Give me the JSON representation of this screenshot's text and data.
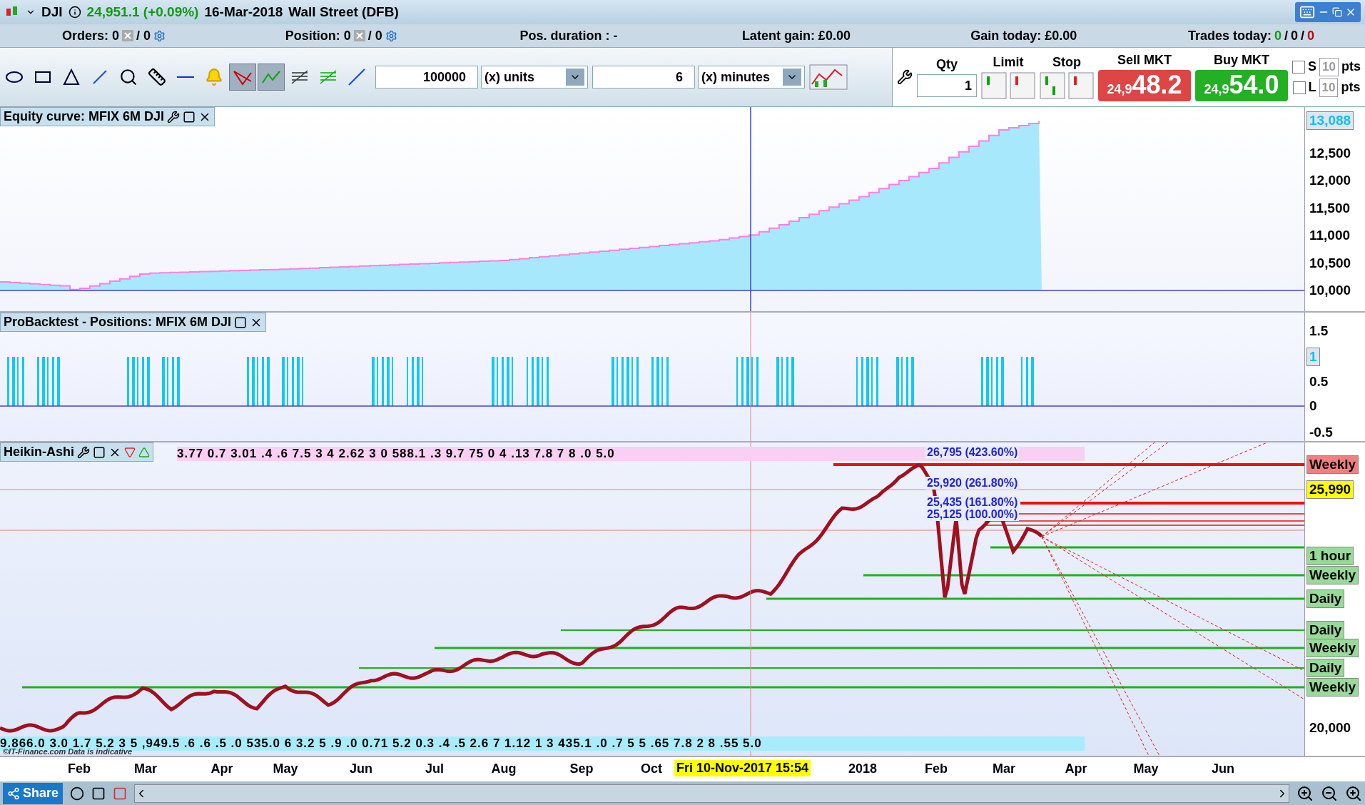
{
  "title_bar": {
    "symbol": "DJI",
    "price": "24,951.1 (+0.09%)",
    "date": "16-Mar-2018",
    "market": "Wall Street (DFB)"
  },
  "info_bar": [
    {
      "kind": "counter",
      "label": "Orders: 0",
      "rest": "/ 0"
    },
    {
      "kind": "counter",
      "label": "Position: 0",
      "rest": "/ 0"
    },
    {
      "kind": "text",
      "label": "Pos. duration : -"
    },
    {
      "kind": "text",
      "label": "Latent gain: £0.00"
    },
    {
      "kind": "text",
      "label": "Gain today: £0.00"
    },
    {
      "kind": "trades",
      "label": "Trades today:",
      "parts": [
        {
          "text": "0",
          "color": "#129a12"
        },
        {
          "text": "/",
          "color": "#000000"
        },
        {
          "text": "0",
          "color": "#000000"
        },
        {
          "text": "/",
          "color": "#000000"
        },
        {
          "text": "0",
          "color": "#c40000"
        }
      ]
    }
  ],
  "toolbar": {
    "tools": [
      {
        "selected": false
      },
      {
        "selected": false
      },
      {
        "selected": false
      },
      {
        "selected": false
      },
      {
        "selected": false
      },
      {
        "selected": false
      },
      {
        "selected": false
      },
      {
        "selected": false
      },
      {
        "selected": true
      },
      {
        "selected": true
      },
      {
        "selected": false
      },
      {
        "selected": false
      },
      {
        "selected": false
      }
    ],
    "quantity": "100000",
    "quantity_unit": "(x) units",
    "period": "6",
    "period_unit": "(x) minutes"
  },
  "order_panel": {
    "qty_label": "Qty",
    "qty": "1",
    "limit_label": "Limit",
    "stop_label": "Stop",
    "sell": {
      "label": "Sell MKT",
      "prefix": "24,9",
      "price": "48.2"
    },
    "buy": {
      "label": "Buy MKT",
      "prefix": "24,9",
      "price": "54.0"
    },
    "offsets": [
      {
        "label": "S",
        "value": "10",
        "unit": "pts",
        "checked": false
      },
      {
        "label": "L",
        "value": "10",
        "unit": "pts",
        "checked": false
      }
    ]
  },
  "equity_panel": {
    "title": "Equity curve: MFIX 6M DJI",
    "current": "13,088",
    "y_ticks": [
      "12,500",
      "12,000",
      "11,500",
      "11,000",
      "10,500",
      "10,000"
    ]
  },
  "positions_panel": {
    "title": "ProBacktest - Positions: MFIX 6M DJI",
    "current": "1",
    "y_ticks": [
      "1.5",
      "0.5",
      "0",
      "-0.5"
    ]
  },
  "price_panel": {
    "title": "Heikin-Ashi",
    "top_ribbon": "3.77 0.7 3.01 .4 .6 7.5 3 4 2.62 3 0 588.1 .3 9.7 75 0 4 .13 7.8 7 8 .0 5.0",
    "bottom_ribbon": "9.866.0 3.0 1.7 5.2 3 5 ,949.5 .6 .6 .5 .0 535.0 6 3.2 5 .9 .0 0.71 5.2 0.3 .4 .5 2.6 7 1.12 1 3 435.1 .0 .7 5 5 .65 7.8 2 8 .55 5.0",
    "credit": "©IT-Finance.com Data is indicative",
    "fib_labels": [
      "26,795 (423.60%)",
      "25,920 (261.80%)",
      "25,435 (161.80%)",
      "25,125 (100.00%)"
    ],
    "current": "25,990",
    "level_tags": [
      {
        "label": "Weekly",
        "color": "#f08080"
      },
      {
        "label": "1 hour",
        "color": "#98da98"
      },
      {
        "label": "Weekly",
        "color": "#98da98"
      },
      {
        "label": "Daily",
        "color": "#98da98"
      },
      {
        "label": "Daily",
        "color": "#98da98"
      },
      {
        "label": "Weekly",
        "color": "#98da98"
      },
      {
        "label": "Daily",
        "color": "#98da98"
      },
      {
        "label": "Weekly",
        "color": "#98da98"
      }
    ],
    "y_ticks": [
      "20,000"
    ]
  },
  "x_axis": {
    "labels": [
      "Feb",
      "Mar",
      "Apr",
      "May",
      "Jun",
      "Jul",
      "Aug",
      "Sep",
      "Oct",
      "2018",
      "Feb",
      "Mar",
      "Apr",
      "May",
      "Jun"
    ],
    "cursor": "Fri 10-Nov-2017 15:54"
  },
  "bottom_bar": {
    "share": "Share"
  }
}
